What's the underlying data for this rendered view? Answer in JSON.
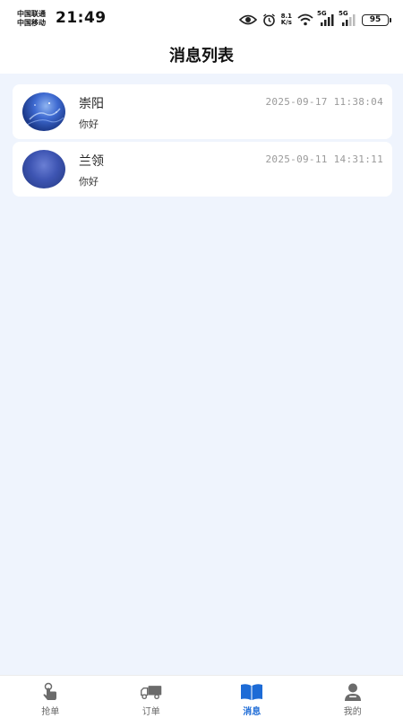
{
  "status_bar": {
    "carrier_1": "中国联通",
    "carrier_2": "中国移动",
    "time": "21:49",
    "speed_top": "8.1",
    "speed_bottom": "K/s",
    "net_1": "5G",
    "net_2": "5G",
    "battery": "95"
  },
  "header": {
    "title": "消息列表"
  },
  "messages": [
    {
      "name": "崇阳",
      "time": "2025-09-17 11:38:04",
      "preview": "你好"
    },
    {
      "name": "兰领",
      "time": "2025-09-11 14:31:11",
      "preview": "你好"
    }
  ],
  "tabs": [
    {
      "label": "抢单",
      "icon": "hand-tap-icon",
      "active": false
    },
    {
      "label": "订单",
      "icon": "truck-icon",
      "active": false
    },
    {
      "label": "消息",
      "icon": "book-open-icon",
      "active": true
    },
    {
      "label": "我的",
      "icon": "user-icon",
      "active": false
    }
  ],
  "colors": {
    "accent": "#1d6bd6",
    "background": "#eff4fd",
    "tab_inactive": "#666666"
  }
}
